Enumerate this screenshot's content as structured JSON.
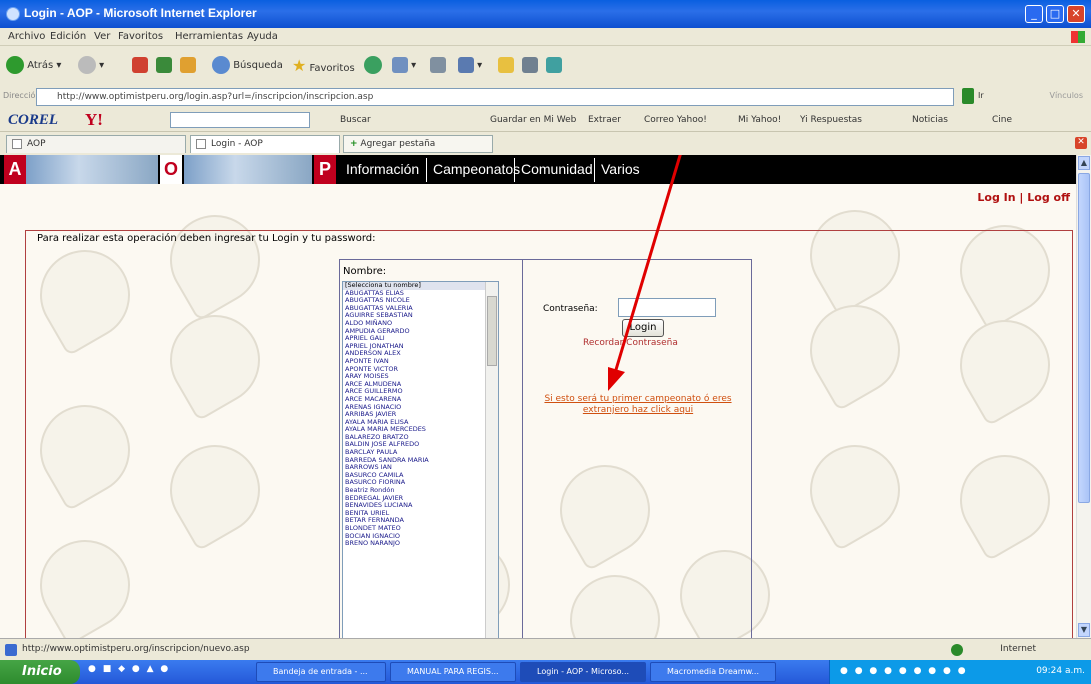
{
  "window": {
    "title": "Login - AOP - Microsoft Internet Explorer",
    "controls": [
      "_",
      "□",
      "✕"
    ]
  },
  "menubar": {
    "items": [
      "Archivo",
      "Edición",
      "Ver",
      "Favoritos",
      "Herramientas",
      "Ayuda"
    ]
  },
  "toolbar": {
    "back": "Atrás",
    "search": "Búsqueda",
    "favorites": "Favoritos"
  },
  "address": {
    "label": "Dirección",
    "url": "http://www.optimistperu.org/login.asp?url=/inscripcion/inscripcion.asp",
    "go": "Ir",
    "links": "Vínculos"
  },
  "corel_toolbar": {
    "brand": "COREL",
    "search_button": "Buscar",
    "items": [
      "Guardar en Mi Web",
      "Extraer",
      "Correo Yahoo!",
      "Mi Yahoo!",
      "Yi Respuestas",
      "Noticias",
      "Cine"
    ]
  },
  "tabs": {
    "items": [
      "AOP",
      "Login - AOP"
    ],
    "new_tab": "Agregar pestaña"
  },
  "site": {
    "letters": [
      "A",
      "O",
      "P"
    ],
    "nav": [
      "Información",
      "Campeonatos",
      "Comunidad",
      "Varios"
    ],
    "log_links": "Log In | Log off",
    "instruction": "Para realizar esta operación deben ingresar tu Login y tu password:",
    "nombre_label": "Nombre:",
    "names": [
      "[Selecciona tu nombre]",
      "ABUGATTAS ELIAS",
      "ABUGATTAS NICOLE",
      "ABUGATTAS VALERIA",
      "AGUIRRE SEBASTIAN",
      "ALDO MIÑANO",
      "AMPUDIA GERARDO",
      "APRIEL GALI",
      "APRIEL JONATHAN",
      "ANDERSON ALEX",
      "APONTE IVAN",
      "APONTE VICTOR",
      "ARAY MOISES",
      "ARCE ALMUDENA",
      "ARCE GUILLERMO",
      "ARCE MACARENA",
      "ARENAS IGNACIO",
      "ARRIBAS JAVIER",
      "AYALA MARIA ELISA",
      "AYALA MARIA MERCEDES",
      "BALAREZO BRATZO",
      "BALDIN JOSE ALFREDO",
      "BARCLAY PAULA",
      "BARREDA SANDRA MARIA",
      "BARROWS IAN",
      "BASURCO CAMILA",
      "BASURCO FIORINA",
      "Beatriz Rondón",
      "BEDREGAL JAVIER",
      "BENAVIDES LUCIANA",
      "BENITA URIEL",
      "BETAR FERNANDA",
      "BLONDET MATEO",
      "BOCIAN IGNACIO",
      "BRENO NARANJO"
    ],
    "password_label": "Contraseña:",
    "login_button": "Login",
    "recordar": "Recordar Contraseña",
    "extranjero_link": "Si esto será tu primer campeonato ó eres extranjero haz click aqui"
  },
  "statusbar": {
    "url": "http://www.optimistperu.org/inscripcion/nuevo.asp",
    "zone": "Internet"
  },
  "taskbar": {
    "start": "Inicio",
    "buttons": [
      "Bandeja de entrada - ...",
      "MANUAL PARA REGIS...",
      "Login - AOP - Microso...",
      "Macromedia Dreamw..."
    ],
    "clock": "09:24 a.m."
  },
  "colors": {
    "header_red": "#c0001e",
    "link_orange": "#d05010",
    "xp_blue": "#0a5fe0"
  }
}
